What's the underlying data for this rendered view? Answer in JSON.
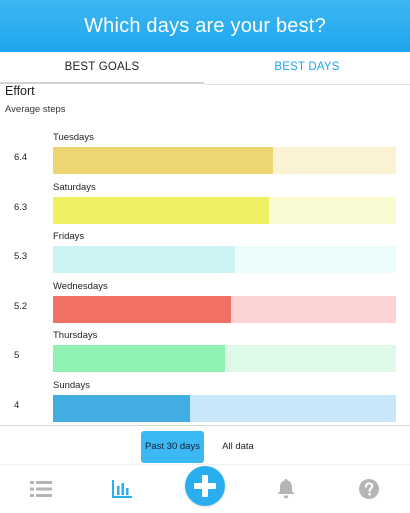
{
  "header": {
    "title": "Which days are your best?"
  },
  "tabs": [
    {
      "label": "BEST GOALS",
      "active": false
    },
    {
      "label": "BEST DAYS",
      "active": true
    }
  ],
  "section": {
    "title": "Effort",
    "subtitle": "Average steps"
  },
  "days": [
    {
      "label": "Tuesdays",
      "score": "6.4",
      "fill_fraction": 0.64,
      "color": "#eed573",
      "track_color": "#fbf2d3"
    },
    {
      "label": "Saturdays",
      "score": "6.3",
      "fill_fraction": 0.63,
      "color": "#f0f162",
      "track_color": "#fbfbd3"
    },
    {
      "label": "Fridays",
      "score": "5.3",
      "fill_fraction": 0.53,
      "color": "#cbf3f3",
      "track_color": "#ecfbfb"
    },
    {
      "label": "Wednesdays",
      "score": "5.2",
      "fill_fraction": 0.52,
      "color": "#f07066",
      "track_color": "#fbd3d3"
    },
    {
      "label": "Thursdays",
      "score": "5",
      "fill_fraction": 0.5,
      "color": "#8ff2b2",
      "track_color": "#dff9e8"
    },
    {
      "label": "Sundays",
      "score": "4",
      "fill_fraction": 0.4,
      "color": "#41ade3",
      "track_color": "#c9e5f9"
    }
  ],
  "range": {
    "past_30_label": "Past 30 days",
    "all_label": "All data",
    "selected": "Past 30 days"
  },
  "nav": {
    "items": [
      "list-icon",
      "chart-icon",
      "plus-icon",
      "bell-icon",
      "help-icon"
    ],
    "active": "chart-icon",
    "active_color": "#29aeef",
    "inactive_color": "#b5b5b5"
  }
}
